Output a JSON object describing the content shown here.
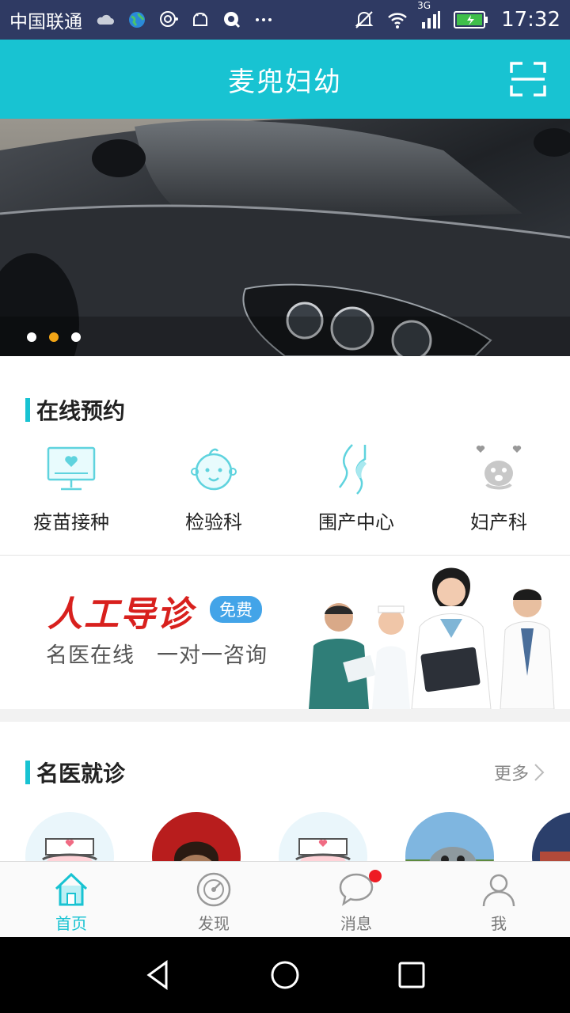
{
  "status_bar": {
    "carrier": "中国联通",
    "network": "3G",
    "time": "17:32"
  },
  "header": {
    "title": "麦兜妇幼"
  },
  "banner": {
    "active_slide": 2,
    "slide_count": 3
  },
  "online_appointment": {
    "title": "在线预约",
    "items": [
      {
        "label": "疫苗接种",
        "icon": "monitor-heart-icon"
      },
      {
        "label": "检验科",
        "icon": "baby-face-icon"
      },
      {
        "label": "围产中心",
        "icon": "pregnancy-icon"
      },
      {
        "label": "妇产科",
        "icon": "baby-hearts-icon"
      }
    ]
  },
  "promo": {
    "title": "人工导诊",
    "badge": "免费",
    "subtitle": "名医在线　一对一咨询"
  },
  "famous_doctors": {
    "title": "名医就诊",
    "more": "更多"
  },
  "tabbar": {
    "items": [
      {
        "label": "首页",
        "icon": "home-icon",
        "active": true
      },
      {
        "label": "发现",
        "icon": "compass-icon",
        "active": false
      },
      {
        "label": "消息",
        "icon": "message-icon",
        "active": false,
        "badge": true
      },
      {
        "label": "我",
        "icon": "user-icon",
        "active": false
      }
    ]
  },
  "colors": {
    "accent": "#18c3d2",
    "promo_red": "#d8201d",
    "badge_blue": "#43a4e8",
    "dot_active": "#f2a516",
    "notification": "#ee1b24"
  }
}
